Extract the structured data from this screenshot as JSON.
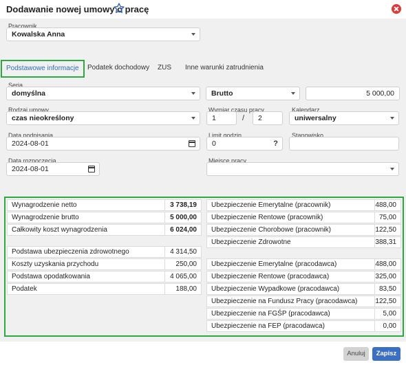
{
  "window": {
    "title": "Dodawanie nowej umowy o pracę"
  },
  "employee": {
    "label": "Pracownik",
    "value": "Kowalska Anna"
  },
  "tabs": [
    {
      "label": "Podstawowe informacje"
    },
    {
      "label": "Podatek dochodowy"
    },
    {
      "label": "ZUS"
    },
    {
      "label": "Inne warunki zatrudnienia"
    }
  ],
  "form": {
    "series_label": "Seria",
    "series_value": "domyślna",
    "salary_type": "Brutto",
    "salary_amount": "5 000,00",
    "contract_type_label": "Rodzaj umowy",
    "contract_type_value": "czas nieokreślony",
    "worktime_label": "Wymiar czasu pracy",
    "worktime_num": "1",
    "worktime_sep": "/",
    "worktime_den": "2",
    "calendar_label": "Kalendarz",
    "calendar_value": "uniwersalny",
    "sign_date_label": "Data podpisania",
    "sign_date_value": "2024-08-01",
    "hours_limit_label": "Limit godzin",
    "hours_limit_value": "0",
    "hours_limit_help": "?",
    "position_label": "Stanowisko",
    "position_value": "",
    "start_date_label": "Data rozpoczęcia",
    "start_date_value": "2024-08-01",
    "workplace_label": "Miejsce pracy",
    "workplace_value": ""
  },
  "summary": {
    "left_main": [
      {
        "k": "Wynagrodzenie netto",
        "v": "3 738,19"
      },
      {
        "k": "Wynagrodzenie brutto",
        "v": "5 000,00"
      },
      {
        "k": "Całkowity koszt wynagrodzenia",
        "v": "6 024,00"
      }
    ],
    "left_extra": [
      {
        "k": "Podstawa ubezpieczenia zdrowotnego",
        "v": "4 314,50"
      },
      {
        "k": "Koszty uzyskania przychodu",
        "v": "250,00"
      },
      {
        "k": "Podstawa opodatkowania",
        "v": "4 065,00"
      },
      {
        "k": "Podatek",
        "v": "188,00"
      }
    ],
    "right_employee": [
      {
        "k": "Ubezpieczenie Emerytalne (pracownik)",
        "v": "488,00"
      },
      {
        "k": "Ubezpieczenie Rentowe (pracownik)",
        "v": "75,00"
      },
      {
        "k": "Ubezpieczenie Chorobowe (pracownik)",
        "v": "122,50"
      },
      {
        "k": "Ubezpieczenie Zdrowotne",
        "v": "388,31"
      }
    ],
    "right_employer": [
      {
        "k": "Ubezpieczenie Emerytalne (pracodawca)",
        "v": "488,00"
      },
      {
        "k": "Ubezpieczenie Rentowe (pracodawca)",
        "v": "325,00"
      },
      {
        "k": "Ubezpieczenie Wypadkowe (pracodawca)",
        "v": "83,50"
      },
      {
        "k": "Ubezpieczenie na Fundusz Pracy (pracodawca)",
        "v": "122,50"
      },
      {
        "k": "Ubezpieczenie na FGŚP (pracodawca)",
        "v": "5,00"
      },
      {
        "k": "Ubezpieczenie na FEP (pracodawca)",
        "v": "0,00"
      }
    ]
  },
  "footer": {
    "cancel_label": "Anuluj",
    "save_label": "Zapisz"
  },
  "colors": {
    "accent": "#3b6fc1",
    "highlight": "#2ca842",
    "close": "#dc3b3b"
  },
  "icons": [
    "star-icon",
    "close-icon",
    "chevron-down-icon",
    "calendar-icon",
    "help-icon"
  ]
}
